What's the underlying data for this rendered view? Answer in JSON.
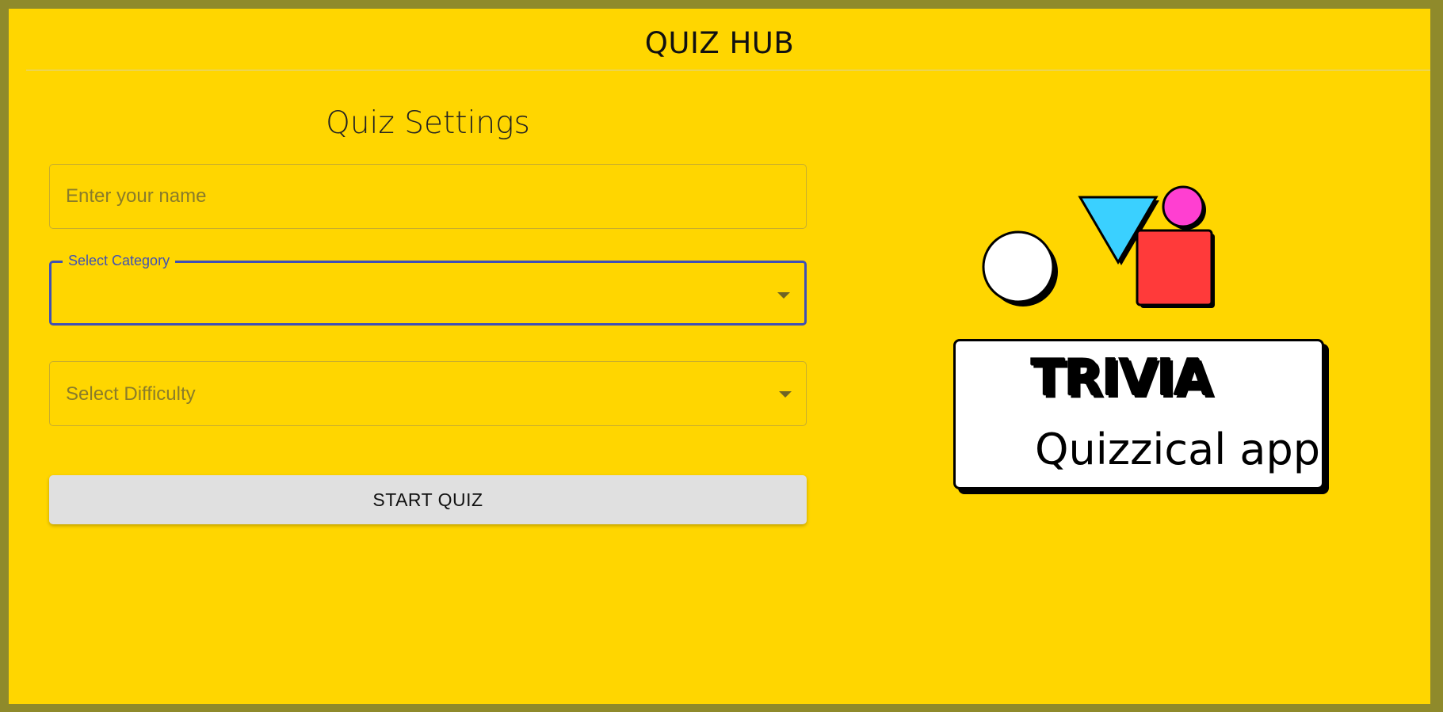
{
  "header": {
    "title": "QUIZ HUB"
  },
  "settings": {
    "title": "Quiz Settings",
    "name_placeholder": "Enter your name",
    "name_value": "",
    "category_label": "Select Category",
    "category_value": "",
    "difficulty_label": "Select Difficulty",
    "difficulty_value": "",
    "start_label": "START QUIZ"
  },
  "logo": {
    "title": "TRIVIA",
    "subtitle": "Quizzical app",
    "shapes": [
      "circle-white",
      "triangle-blue",
      "circle-pink",
      "square-red"
    ]
  },
  "colors": {
    "background": "#ffd600",
    "border": "#8f8a2b",
    "focus": "#3f51b5",
    "button": "#e0e0e0"
  }
}
